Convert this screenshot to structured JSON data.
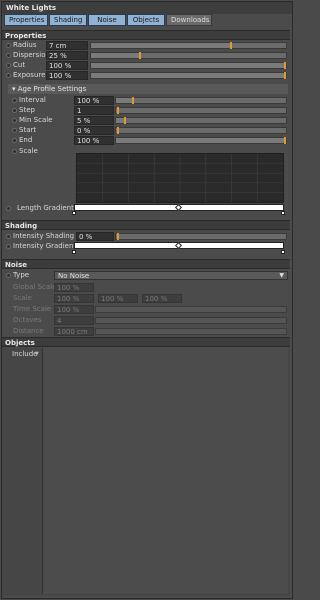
{
  "window": {
    "title": "White Lights"
  },
  "tabs": [
    "Properties",
    "Shading",
    "Noise",
    "Objects",
    "Downloads"
  ],
  "sections": {
    "properties": "Properties",
    "age_profile": "Age Profile Settings",
    "shading": "Shading",
    "noise": "Noise",
    "objects": "Objects"
  },
  "properties": {
    "radius": {
      "label": "Radius",
      "value": "7 cm",
      "level": 0.78
    },
    "dispersion": {
      "label": "Dispersion",
      "value": "25 %",
      "level": 0.25
    },
    "cut": {
      "label": "Cut",
      "value": "100 %",
      "level": 1.0
    },
    "exposure": {
      "label": "Exposure",
      "value": "100 %",
      "level": 1.0
    }
  },
  "age_profile": {
    "interval": {
      "label": "Interval",
      "value": "100 %",
      "level": 0.1
    },
    "step": {
      "label": "Step",
      "value": "1",
      "level": 0.0
    },
    "min_scale": {
      "label": "Min Scale",
      "value": "5 %",
      "level": 0.05
    },
    "start": {
      "label": "Start",
      "value": "0 %",
      "level": 0.0
    },
    "end": {
      "label": "End",
      "value": "100 %",
      "level": 1.0
    },
    "scale": {
      "label": "Scale"
    },
    "length_gradient": {
      "label": "Length Gradient"
    }
  },
  "shading": {
    "intensity_shading": {
      "label": "Intensity Shading",
      "value": "0 %",
      "level": 0.0
    },
    "intensity_gradient": {
      "label": "Intensity Gradient"
    }
  },
  "noise": {
    "type": {
      "label": "Type",
      "value": "No Noise"
    },
    "global_scale": {
      "label": "Global Scale",
      "value": "100 %"
    },
    "scale": {
      "label": "Scale",
      "values": [
        "100 %",
        "100 %",
        "100 %"
      ]
    },
    "time_scale": {
      "label": "Time Scale",
      "value": "100 %"
    },
    "octaves": {
      "label": "Octaves",
      "value": "4"
    },
    "distance": {
      "label": "Distance",
      "value": "1000 cm"
    }
  },
  "objects": {
    "include_label": "Include"
  },
  "colors": {
    "accent": "#e09a2e",
    "tab_active": "#8fb1d3"
  }
}
